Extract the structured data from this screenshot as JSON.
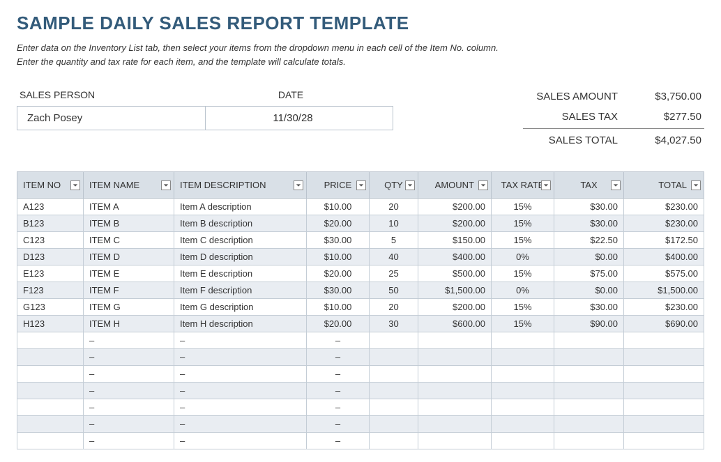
{
  "title": "SAMPLE DAILY SALES REPORT TEMPLATE",
  "instructions_line1": "Enter data on the Inventory List tab, then select your items from the dropdown menu in each cell of the Item No. column.",
  "instructions_line2": "Enter the quantity and tax rate for each item, and the template will calculate totals.",
  "labels": {
    "sales_person": "SALES PERSON",
    "date": "DATE",
    "sales_amount": "SALES AMOUNT",
    "sales_tax": "SALES TAX",
    "sales_total": "SALES TOTAL"
  },
  "info": {
    "sales_person": "Zach Posey",
    "date": "11/30/28"
  },
  "summary": {
    "sales_amount": "$3,750.00",
    "sales_tax": "$277.50",
    "sales_total": "$4,027.50"
  },
  "columns": {
    "item_no": "ITEM NO",
    "item_name": "ITEM NAME",
    "item_description": "ITEM DESCRIPTION",
    "price": "PRICE",
    "qty": "QTY",
    "amount": "AMOUNT",
    "tax_rate": "TAX RATE",
    "tax": "TAX",
    "total": "TOTAL"
  },
  "rows": [
    {
      "item_no": "A123",
      "item_name": "ITEM A",
      "item_description": "Item A description",
      "price": "$10.00",
      "qty": "20",
      "amount": "$200.00",
      "tax_rate": "15%",
      "tax": "$30.00",
      "total": "$230.00"
    },
    {
      "item_no": "B123",
      "item_name": "ITEM B",
      "item_description": "Item B description",
      "price": "$20.00",
      "qty": "10",
      "amount": "$200.00",
      "tax_rate": "15%",
      "tax": "$30.00",
      "total": "$230.00"
    },
    {
      "item_no": "C123",
      "item_name": "ITEM C",
      "item_description": "Item C description",
      "price": "$30.00",
      "qty": "5",
      "amount": "$150.00",
      "tax_rate": "15%",
      "tax": "$22.50",
      "total": "$172.50"
    },
    {
      "item_no": "D123",
      "item_name": "ITEM D",
      "item_description": "Item D description",
      "price": "$10.00",
      "qty": "40",
      "amount": "$400.00",
      "tax_rate": "0%",
      "tax": "$0.00",
      "total": "$400.00"
    },
    {
      "item_no": "E123",
      "item_name": "ITEM E",
      "item_description": "Item E description",
      "price": "$20.00",
      "qty": "25",
      "amount": "$500.00",
      "tax_rate": "15%",
      "tax": "$75.00",
      "total": "$575.00"
    },
    {
      "item_no": "F123",
      "item_name": "ITEM F",
      "item_description": "Item F description",
      "price": "$30.00",
      "qty": "50",
      "amount": "$1,500.00",
      "tax_rate": "0%",
      "tax": "$0.00",
      "total": "$1,500.00"
    },
    {
      "item_no": "G123",
      "item_name": "ITEM G",
      "item_description": "Item G description",
      "price": "$10.00",
      "qty": "20",
      "amount": "$200.00",
      "tax_rate": "15%",
      "tax": "$30.00",
      "total": "$230.00"
    },
    {
      "item_no": "H123",
      "item_name": "ITEM H",
      "item_description": "Item H description",
      "price": "$20.00",
      "qty": "30",
      "amount": "$600.00",
      "tax_rate": "15%",
      "tax": "$90.00",
      "total": "$690.00"
    },
    {
      "item_no": "",
      "item_name": "–",
      "item_description": "–",
      "price": "–",
      "qty": "",
      "amount": "",
      "tax_rate": "",
      "tax": "",
      "total": ""
    },
    {
      "item_no": "",
      "item_name": "–",
      "item_description": "–",
      "price": "–",
      "qty": "",
      "amount": "",
      "tax_rate": "",
      "tax": "",
      "total": ""
    },
    {
      "item_no": "",
      "item_name": "–",
      "item_description": "–",
      "price": "–",
      "qty": "",
      "amount": "",
      "tax_rate": "",
      "tax": "",
      "total": ""
    },
    {
      "item_no": "",
      "item_name": "–",
      "item_description": "–",
      "price": "–",
      "qty": "",
      "amount": "",
      "tax_rate": "",
      "tax": "",
      "total": ""
    },
    {
      "item_no": "",
      "item_name": "–",
      "item_description": "–",
      "price": "–",
      "qty": "",
      "amount": "",
      "tax_rate": "",
      "tax": "",
      "total": ""
    },
    {
      "item_no": "",
      "item_name": "–",
      "item_description": "–",
      "price": "–",
      "qty": "",
      "amount": "",
      "tax_rate": "",
      "tax": "",
      "total": ""
    },
    {
      "item_no": "",
      "item_name": "–",
      "item_description": "–",
      "price": "–",
      "qty": "",
      "amount": "",
      "tax_rate": "",
      "tax": "",
      "total": ""
    }
  ],
  "chart_data": {
    "type": "table",
    "title": "Sample Daily Sales Report",
    "columns": [
      "ITEM NO",
      "ITEM NAME",
      "ITEM DESCRIPTION",
      "PRICE",
      "QTY",
      "AMOUNT",
      "TAX RATE",
      "TAX",
      "TOTAL"
    ],
    "rows": [
      [
        "A123",
        "ITEM A",
        "Item A description",
        10.0,
        20,
        200.0,
        0.15,
        30.0,
        230.0
      ],
      [
        "B123",
        "ITEM B",
        "Item B description",
        20.0,
        10,
        200.0,
        0.15,
        30.0,
        230.0
      ],
      [
        "C123",
        "ITEM C",
        "Item C description",
        30.0,
        5,
        150.0,
        0.15,
        22.5,
        172.5
      ],
      [
        "D123",
        "ITEM D",
        "Item D description",
        10.0,
        40,
        400.0,
        0.0,
        0.0,
        400.0
      ],
      [
        "E123",
        "ITEM E",
        "Item E description",
        20.0,
        25,
        500.0,
        0.15,
        75.0,
        575.0
      ],
      [
        "F123",
        "ITEM F",
        "Item F description",
        30.0,
        50,
        1500.0,
        0.0,
        0.0,
        1500.0
      ],
      [
        "G123",
        "ITEM G",
        "Item G description",
        10.0,
        20,
        200.0,
        0.15,
        30.0,
        230.0
      ],
      [
        "H123",
        "ITEM H",
        "Item H description",
        20.0,
        30,
        600.0,
        0.15,
        90.0,
        690.0
      ]
    ],
    "summary": {
      "sales_amount": 3750.0,
      "sales_tax": 277.5,
      "sales_total": 4027.5
    }
  }
}
